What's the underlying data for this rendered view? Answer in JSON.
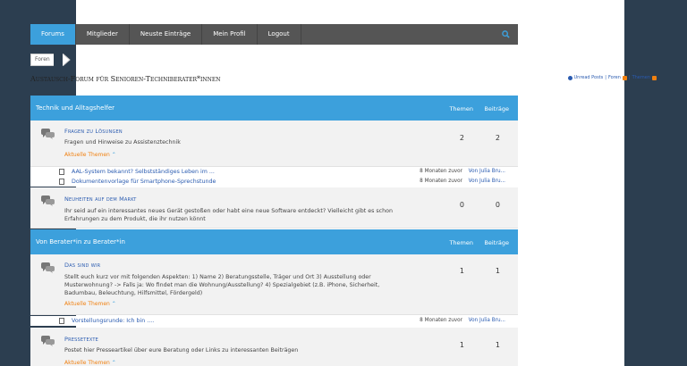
{
  "nav": {
    "items": [
      "Forums",
      "Mitglieder",
      "Neuste Einträge",
      "Mein Profil",
      "Logout"
    ],
    "active_color": "#3ca0dc"
  },
  "breadcrumb": {
    "label": "Foren"
  },
  "page": {
    "title": "Austausch-Forum für Senioren-Techniberater*innen"
  },
  "header_links": {
    "unread": "Unread Posts",
    "forums": "Foren",
    "topics": "Themen"
  },
  "sections": [
    {
      "name": "Technik und Alltagshelfer",
      "col_topics": "Themen",
      "col_posts": "Beiträge",
      "forums": [
        {
          "title": "Fragen zu Lösungen",
          "desc": "Fragen und Hinweise zu Assistenztechnik",
          "recent": "Aktuelle Themen",
          "topics": "2",
          "posts": "2",
          "threads": [
            {
              "title": "AAL-System bekannt? Selbstständiges Leben im ...",
              "age": "8 Monaten zuvor",
              "by": "Von Julia Bru..."
            },
            {
              "title": "Dokumentenvorlage für Smartphone-Sprechstunde",
              "age": "8 Monaten zuvor",
              "by": "Von Julia Bru..."
            }
          ]
        },
        {
          "title": "Neuheiten auf dem Markt",
          "desc": "Ihr seid auf ein interessantes neues Gerät gestoßen oder habt eine neue Software entdeckt? Vielleicht gibt es schon Erfahrungen zu dem Produkt, die ihr nutzen könnt",
          "topics": "0",
          "posts": "0"
        }
      ]
    },
    {
      "name": "Von Berater*in zu Berater*in",
      "col_topics": "Themen",
      "col_posts": "Beiträge",
      "forums": [
        {
          "title": "Das sind wir",
          "desc": "Stellt euch kurz vor mit folgenden Aspekten: 1) Name 2) Beratungsstelle, Träger und Ort 3) Ausstellung oder Musterwohnung? -> Falls ja: Wo findet man die Wohnung/Ausstellung? 4) Spezialgebiet (z.B. iPhone, Sicherheit, Badumbau, Beleuchtung, Hilfsmittel, Fördergeld)",
          "recent": "Aktuelle Themen",
          "topics": "1",
          "posts": "1",
          "threads": [
            {
              "title": "Vorstellungsrunde: Ich bin ....",
              "age": "8 Monaten zuvor",
              "by": "Von Julia Bru..."
            }
          ]
        },
        {
          "title": "Pressetexte",
          "desc": "Postet hier Presseartikel über eure Beratung oder Links zu interessanten Beiträgen",
          "recent": "Aktuelle Themen",
          "topics": "1",
          "posts": "1"
        }
      ]
    }
  ]
}
